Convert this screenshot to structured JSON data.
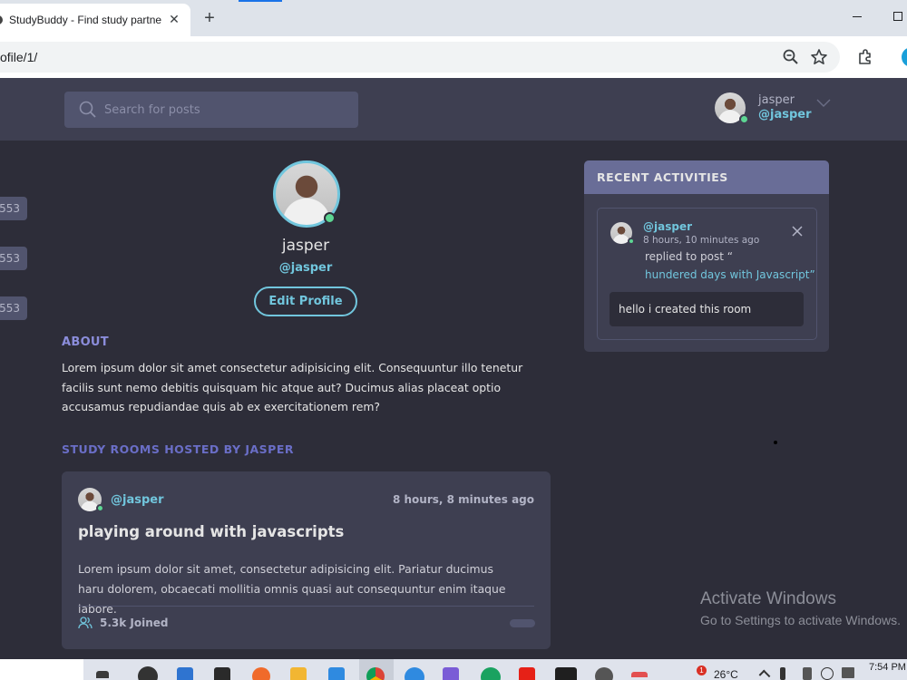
{
  "browser": {
    "tab_title": "StudyBuddy - Find study partners",
    "tab_close": "✕",
    "new_tab": "+",
    "url": "ofile/1/"
  },
  "header": {
    "search_placeholder": "Search for posts",
    "user_name": "jasper",
    "user_handle": "@jasper"
  },
  "topics": {
    "counts": [
      "553",
      "553",
      "553"
    ]
  },
  "profile": {
    "name": "jasper",
    "handle": "@jasper",
    "edit_label": "Edit Profile",
    "about_title": "ABOUT",
    "about_text": "Lorem ipsum dolor sit amet consectetur adipisicing elit. Consequuntur illo tenetur facilis sunt nemo debitis quisquam hic atque aut? Ducimus alias placeat optio accusamus repudiandae quis ab ex exercitationem rem?",
    "rooms_title": "STUDY ROOMS HOSTED BY JASPER"
  },
  "room": {
    "author": "@jasper",
    "time": "8 hours, 8 minutes ago",
    "title": "playing around with javascripts",
    "description": "Lorem ipsum dolor sit amet, consectetur adipisicing elit. Pariatur ducimus haru dolorem, obcaecati mollitia omnis quasi aut consequuntur enim itaque labore.",
    "joined": "5.3k Joined"
  },
  "activities": {
    "title": "RECENT ACTIVITIES",
    "items": [
      {
        "handle": "@jasper",
        "time": "8 hours, 10 minutes ago",
        "action": "replied to post “",
        "post": "hundered days with Javascript”",
        "reply": "hello i created this room"
      }
    ]
  },
  "watermark": {
    "title": "Activate Windows",
    "subtitle": "Go to Settings to activate Windows."
  },
  "taskbar": {
    "temperature": "26°C",
    "time": "7:54 PM",
    "notification_count": "1"
  },
  "colors": {
    "background": "#2d2d39",
    "panel": "#3e3f51",
    "accent": "#71c6dd",
    "header_bar": "#696d97",
    "online": "#5dd693"
  }
}
